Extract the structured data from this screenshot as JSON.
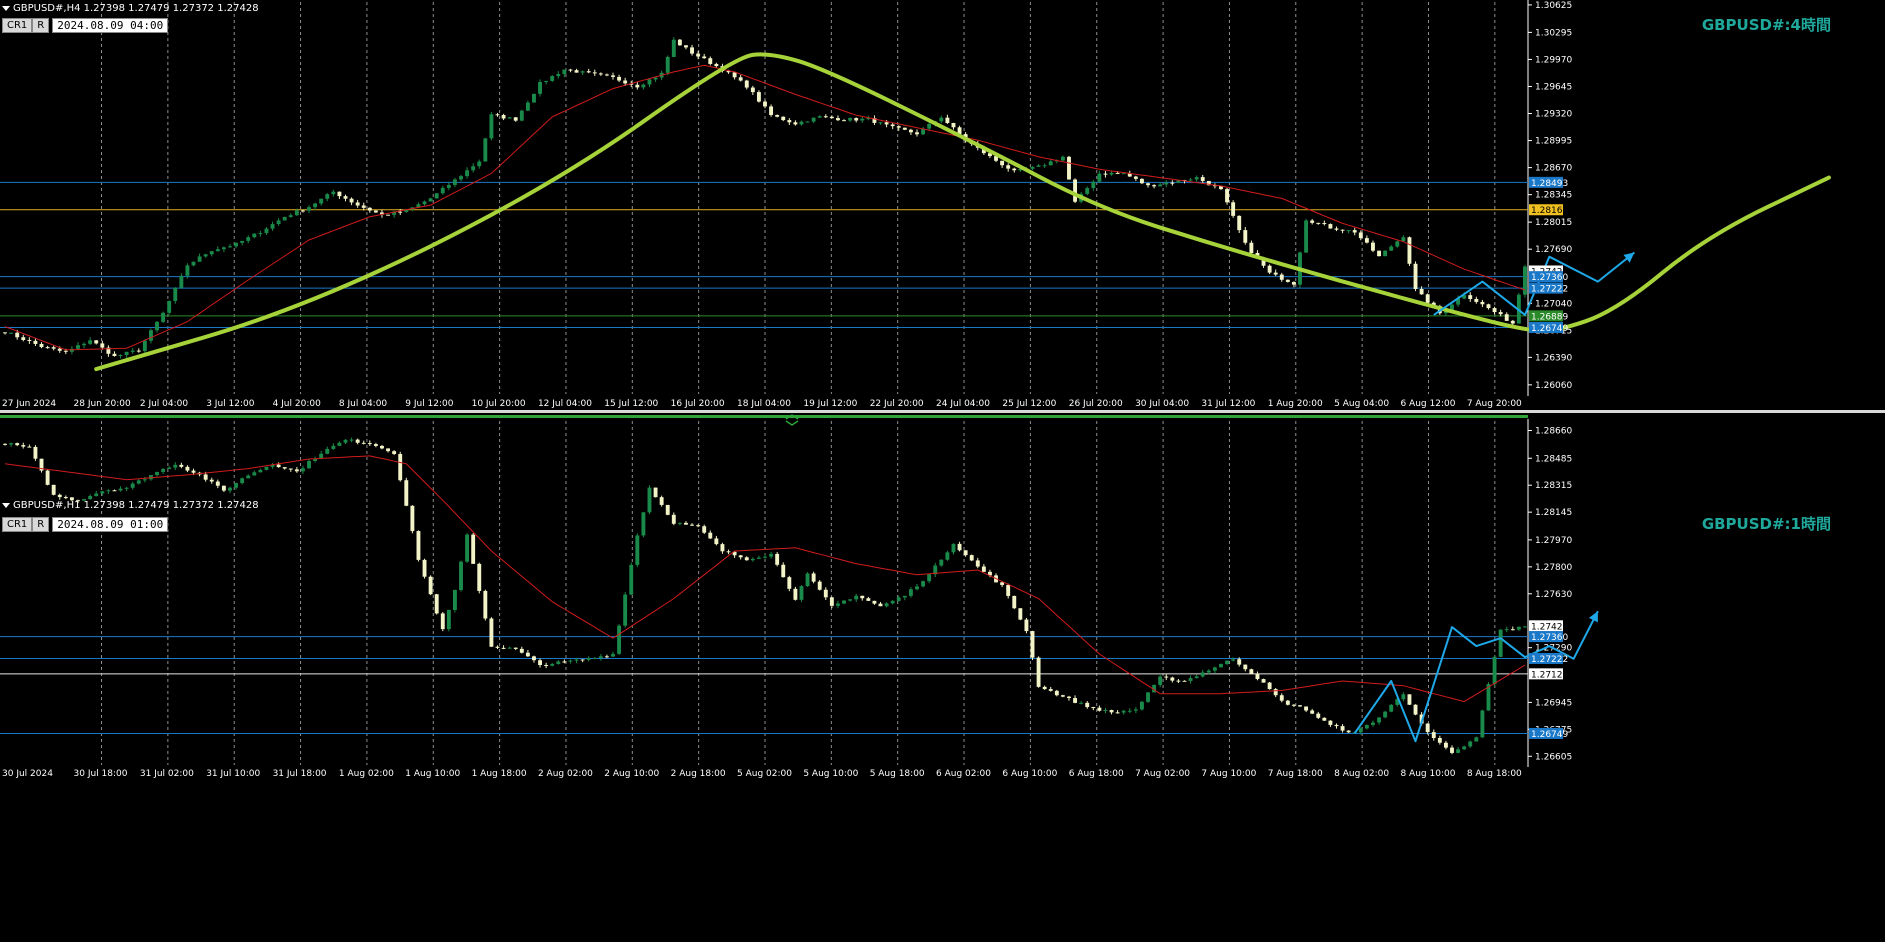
{
  "colors": {
    "background": "#000000",
    "grid": "#bdbdbd",
    "bull_candle": "#1a8a4a",
    "bear_candle": "#f3f3c8",
    "ma_line": "#d11c1c",
    "h_line_blue": "#1a78c8",
    "h_line_yellow": "#e0b020",
    "h_line_green": "#2a8a2a",
    "h_line_white": "#e6e6e6",
    "green_curve": "#a6d23a",
    "blue_path": "#1ea8e8",
    "title_text": "#1fa99c",
    "label_blue_bg": "#1a78c8",
    "label_yellow_bg": "#f0c020"
  },
  "icons": {
    "collapse": "triangle-down-icon",
    "separator": "panel-separator-icon"
  },
  "panels": [
    {
      "id": "h4",
      "header": "GBPUSD#,H4  1.27398 1.27479 1.27372 1.27428",
      "btn1": "CR1",
      "btn2": "R",
      "datetime": "2024.08.09 04:00",
      "title": "GBPUSD#:4時間",
      "y_ticks": [
        "1.30625",
        "1.30295",
        "1.29970",
        "1.29645",
        "1.29320",
        "1.28995",
        "1.28670",
        "1.28345",
        "1.28015",
        "1.27690",
        "1.27040",
        "1.26715",
        "1.26390",
        "1.26060"
      ],
      "x_ticks": [
        "27 Jun 2024",
        "28 Jun 20:00",
        "2 Jul 04:00",
        "3 Jul 12:00",
        "4 Jul 20:00",
        "8 Jul 04:00",
        "9 Jul 12:00",
        "10 Jul 20:00",
        "12 Jul 04:00",
        "15 Jul 12:00",
        "16 Jul 20:00",
        "18 Jul 04:00",
        "19 Jul 12:00",
        "22 Jul 20:00",
        "24 Jul 04:00",
        "25 Jul 12:00",
        "26 Jul 20:00",
        "30 Jul 04:00",
        "31 Jul 12:00",
        "1 Aug 20:00",
        "5 Aug 04:00",
        "6 Aug 12:00",
        "7 Aug 20:00"
      ],
      "price_labels": [
        {
          "text": "1.28493",
          "color": "blue"
        },
        {
          "text": "1.28164",
          "color": "yellow"
        },
        {
          "text": "1.27428",
          "color": "white"
        },
        {
          "text": "1.27360",
          "color": "blue"
        },
        {
          "text": "1.27222",
          "color": "blue"
        },
        {
          "text": "1.26889",
          "color": "green"
        },
        {
          "text": "1.26749",
          "color": "blue"
        }
      ]
    },
    {
      "id": "h1",
      "header": "GBPUSD#,H1  1.27398 1.27479 1.27372 1.27428",
      "btn1": "CR1",
      "btn2": "R",
      "datetime": "2024.08.09 01:00",
      "title": "GBPUSD#:1時間",
      "y_ticks": [
        "1.28660",
        "1.28485",
        "1.28315",
        "1.28145",
        "1.27970",
        "1.27800",
        "1.27630",
        "1.27290",
        "1.26945",
        "1.26775",
        "1.26605"
      ],
      "x_ticks": [
        "30 Jul 2024",
        "30 Jul 18:00",
        "31 Jul 02:00",
        "31 Jul 10:00",
        "31 Jul 18:00",
        "1 Aug 02:00",
        "1 Aug 10:00",
        "1 Aug 18:00",
        "2 Aug 02:00",
        "2 Aug 10:00",
        "2 Aug 18:00",
        "5 Aug 02:00",
        "5 Aug 10:00",
        "5 Aug 18:00",
        "6 Aug 02:00",
        "6 Aug 10:00",
        "6 Aug 18:00",
        "7 Aug 02:00",
        "7 Aug 10:00",
        "7 Aug 18:00",
        "8 Aug 02:00",
        "8 Aug 10:00",
        "8 Aug 18:00"
      ],
      "price_labels": [
        {
          "text": "1.27428",
          "color": "white"
        },
        {
          "text": "1.27360",
          "color": "blue"
        },
        {
          "text": "1.27222",
          "color": "blue"
        },
        {
          "text": "1.27125",
          "color": "white"
        },
        {
          "text": "1.26749",
          "color": "blue"
        }
      ]
    }
  ],
  "chart_data": [
    {
      "type": "candlestick",
      "title": "GBPUSD#:4時間",
      "symbol": "GBPUSD#",
      "timeframe": "H4",
      "ohlc_last": {
        "open": 1.27398,
        "high": 1.27479,
        "low": 1.27372,
        "close": 1.27428
      },
      "ylim": [
        1.2595,
        1.3066
      ],
      "h_lines": [
        {
          "price": 1.28493,
          "color": "blue"
        },
        {
          "price": 1.28164,
          "color": "yellow"
        },
        {
          "price": 1.2736,
          "color": "blue"
        },
        {
          "price": 1.27222,
          "color": "blue"
        },
        {
          "price": 1.26889,
          "color": "green"
        },
        {
          "price": 1.26749,
          "color": "blue"
        }
      ],
      "close_anchors": [
        [
          0,
          1.267
        ],
        [
          6,
          1.2652
        ],
        [
          10,
          1.2645
        ],
        [
          14,
          1.266
        ],
        [
          18,
          1.264
        ],
        [
          22,
          1.2648
        ],
        [
          26,
          1.2692
        ],
        [
          30,
          1.275
        ],
        [
          34,
          1.2768
        ],
        [
          38,
          1.2775
        ],
        [
          42,
          1.279
        ],
        [
          46,
          1.2808
        ],
        [
          50,
          1.282
        ],
        [
          54,
          1.2838
        ],
        [
          58,
          1.2822
        ],
        [
          62,
          1.281
        ],
        [
          66,
          1.2815
        ],
        [
          70,
          1.283
        ],
        [
          74,
          1.2852
        ],
        [
          78,
          1.2875
        ],
        [
          80,
          1.293
        ],
        [
          84,
          1.2925
        ],
        [
          88,
          1.2968
        ],
        [
          92,
          1.2985
        ],
        [
          96,
          1.298
        ],
        [
          100,
          1.2975
        ],
        [
          104,
          1.2965
        ],
        [
          108,
          1.298
        ],
        [
          110,
          1.302
        ],
        [
          113,
          1.3005
        ],
        [
          118,
          1.2985
        ],
        [
          122,
          1.2965
        ],
        [
          126,
          1.293
        ],
        [
          130,
          1.292
        ],
        [
          134,
          1.2928
        ],
        [
          138,
          1.2925
        ],
        [
          142,
          1.2925
        ],
        [
          146,
          1.2915
        ],
        [
          150,
          1.2908
        ],
        [
          154,
          1.2928
        ],
        [
          158,
          1.29
        ],
        [
          162,
          1.288
        ],
        [
          166,
          1.2862
        ],
        [
          170,
          1.2868
        ],
        [
          174,
          1.288
        ],
        [
          176,
          1.2825
        ],
        [
          180,
          1.286
        ],
        [
          184,
          1.286
        ],
        [
          188,
          1.2845
        ],
        [
          192,
          1.285
        ],
        [
          196,
          1.2855
        ],
        [
          200,
          1.284
        ],
        [
          204,
          1.2775
        ],
        [
          208,
          1.274
        ],
        [
          212,
          1.2728
        ],
        [
          214,
          1.2805
        ],
        [
          218,
          1.2795
        ],
        [
          222,
          1.279
        ],
        [
          226,
          1.276
        ],
        [
          230,
          1.2785
        ],
        [
          232,
          1.272
        ],
        [
          236,
          1.2692
        ],
        [
          240,
          1.2715
        ],
        [
          244,
          1.2698
        ],
        [
          248,
          1.268
        ],
        [
          250,
          1.275
        ]
      ],
      "ma_anchors": [
        [
          0,
          1.2676
        ],
        [
          10,
          1.2648
        ],
        [
          20,
          1.265
        ],
        [
          30,
          1.2682
        ],
        [
          40,
          1.2732
        ],
        [
          50,
          1.278
        ],
        [
          60,
          1.2808
        ],
        [
          70,
          1.2822
        ],
        [
          80,
          1.286
        ],
        [
          90,
          1.2928
        ],
        [
          100,
          1.2962
        ],
        [
          110,
          1.2982
        ],
        [
          115,
          1.299
        ],
        [
          120,
          1.2982
        ],
        [
          130,
          1.2955
        ],
        [
          140,
          1.293
        ],
        [
          150,
          1.2915
        ],
        [
          160,
          1.29
        ],
        [
          170,
          1.288
        ],
        [
          180,
          1.2865
        ],
        [
          190,
          1.2855
        ],
        [
          200,
          1.2845
        ],
        [
          210,
          1.283
        ],
        [
          220,
          1.28
        ],
        [
          230,
          1.2778
        ],
        [
          240,
          1.2745
        ],
        [
          250,
          1.272
        ]
      ],
      "green_curve": [
        [
          15,
          1.2625
        ],
        [
          50,
          1.27
        ],
        [
          90,
          1.2845
        ],
        [
          120,
          1.3
        ],
        [
          126,
          1.3005
        ],
        [
          135,
          1.2985
        ],
        [
          160,
          1.2895
        ],
        [
          180,
          1.2818
        ],
        [
          200,
          1.2772
        ],
        [
          220,
          1.273
        ],
        [
          240,
          1.269
        ],
        [
          250,
          1.2672
        ],
        [
          255,
          1.267
        ],
        [
          265,
          1.2695
        ],
        [
          280,
          1.2785
        ],
        [
          300,
          1.2855
        ]
      ],
      "blue_path": [
        [
          235,
          1.269
        ],
        [
          243,
          1.273
        ],
        [
          250,
          1.269
        ],
        [
          254,
          1.276
        ],
        [
          262,
          1.273
        ],
        [
          268,
          1.2765
        ]
      ]
    },
    {
      "type": "candlestick",
      "title": "GBPUSD#:1時間",
      "symbol": "GBPUSD#",
      "timeframe": "H1",
      "ohlc_last": {
        "open": 1.27398,
        "high": 1.27479,
        "low": 1.27372,
        "close": 1.27428
      },
      "ylim": [
        1.2655,
        1.2872
      ],
      "h_lines": [
        {
          "price": 1.2736,
          "color": "blue"
        },
        {
          "price": 1.27222,
          "color": "blue"
        },
        {
          "price": 1.27125,
          "color": "white"
        },
        {
          "price": 1.26749,
          "color": "blue"
        }
      ],
      "close_anchors": [
        [
          0,
          1.2858
        ],
        [
          4,
          1.2855
        ],
        [
          8,
          1.2825
        ],
        [
          12,
          1.2822
        ],
        [
          16,
          1.2828
        ],
        [
          20,
          1.283
        ],
        [
          24,
          1.2838
        ],
        [
          28,
          1.2845
        ],
        [
          32,
          1.2838
        ],
        [
          36,
          1.2828
        ],
        [
          40,
          1.2838
        ],
        [
          44,
          1.2845
        ],
        [
          48,
          1.284
        ],
        [
          52,
          1.2852
        ],
        [
          56,
          1.286
        ],
        [
          60,
          1.2858
        ],
        [
          64,
          1.2852
        ],
        [
          68,
          1.2785
        ],
        [
          72,
          1.274
        ],
        [
          74,
          1.2765
        ],
        [
          76,
          1.28
        ],
        [
          80,
          1.273
        ],
        [
          84,
          1.2728
        ],
        [
          88,
          1.2718
        ],
        [
          92,
          1.272
        ],
        [
          96,
          1.2722
        ],
        [
          100,
          1.2725
        ],
        [
          104,
          1.28
        ],
        [
          106,
          1.283
        ],
        [
          110,
          1.2808
        ],
        [
          114,
          1.2805
        ],
        [
          118,
          1.279
        ],
        [
          122,
          1.2785
        ],
        [
          126,
          1.2788
        ],
        [
          130,
          1.276
        ],
        [
          132,
          1.2775
        ],
        [
          136,
          1.2755
        ],
        [
          140,
          1.2762
        ],
        [
          144,
          1.2755
        ],
        [
          148,
          1.2762
        ],
        [
          152,
          1.2775
        ],
        [
          156,
          1.2795
        ],
        [
          160,
          1.278
        ],
        [
          164,
          1.2768
        ],
        [
          168,
          1.274
        ],
        [
          170,
          1.2705
        ],
        [
          174,
          1.2698
        ],
        [
          178,
          1.2692
        ],
        [
          182,
          1.2688
        ],
        [
          186,
          1.269
        ],
        [
          190,
          1.271
        ],
        [
          194,
          1.2708
        ],
        [
          198,
          1.2715
        ],
        [
          202,
          1.2722
        ],
        [
          206,
          1.271
        ],
        [
          210,
          1.2695
        ],
        [
          214,
          1.269
        ],
        [
          218,
          1.268
        ],
        [
          222,
          1.2675
        ],
        [
          226,
          1.2685
        ],
        [
          230,
          1.27
        ],
        [
          234,
          1.2675
        ],
        [
          238,
          1.2662
        ],
        [
          242,
          1.2672
        ],
        [
          246,
          1.274
        ],
        [
          250,
          1.2742
        ]
      ],
      "ma_anchors": [
        [
          0,
          1.2845
        ],
        [
          10,
          1.284
        ],
        [
          20,
          1.2835
        ],
        [
          30,
          1.2838
        ],
        [
          40,
          1.2842
        ],
        [
          50,
          1.2848
        ],
        [
          60,
          1.285
        ],
        [
          66,
          1.2845
        ],
        [
          72,
          1.2822
        ],
        [
          80,
          1.279
        ],
        [
          90,
          1.2758
        ],
        [
          100,
          1.2735
        ],
        [
          110,
          1.276
        ],
        [
          120,
          1.279
        ],
        [
          130,
          1.2792
        ],
        [
          140,
          1.2782
        ],
        [
          150,
          1.2775
        ],
        [
          160,
          1.2778
        ],
        [
          170,
          1.276
        ],
        [
          180,
          1.2725
        ],
        [
          190,
          1.27
        ],
        [
          200,
          1.27
        ],
        [
          210,
          1.2702
        ],
        [
          220,
          1.2708
        ],
        [
          230,
          1.2705
        ],
        [
          240,
          1.2695
        ],
        [
          250,
          1.2718
        ]
      ],
      "blue_path": [
        [
          222,
          1.2675
        ],
        [
          228,
          1.2708
        ],
        [
          232,
          1.267
        ],
        [
          238,
          1.2742
        ],
        [
          242,
          1.273
        ],
        [
          246,
          1.2735
        ],
        [
          250,
          1.2723
        ],
        [
          254,
          1.273
        ],
        [
          258,
          1.2722
        ],
        [
          262,
          1.2752
        ]
      ]
    }
  ]
}
